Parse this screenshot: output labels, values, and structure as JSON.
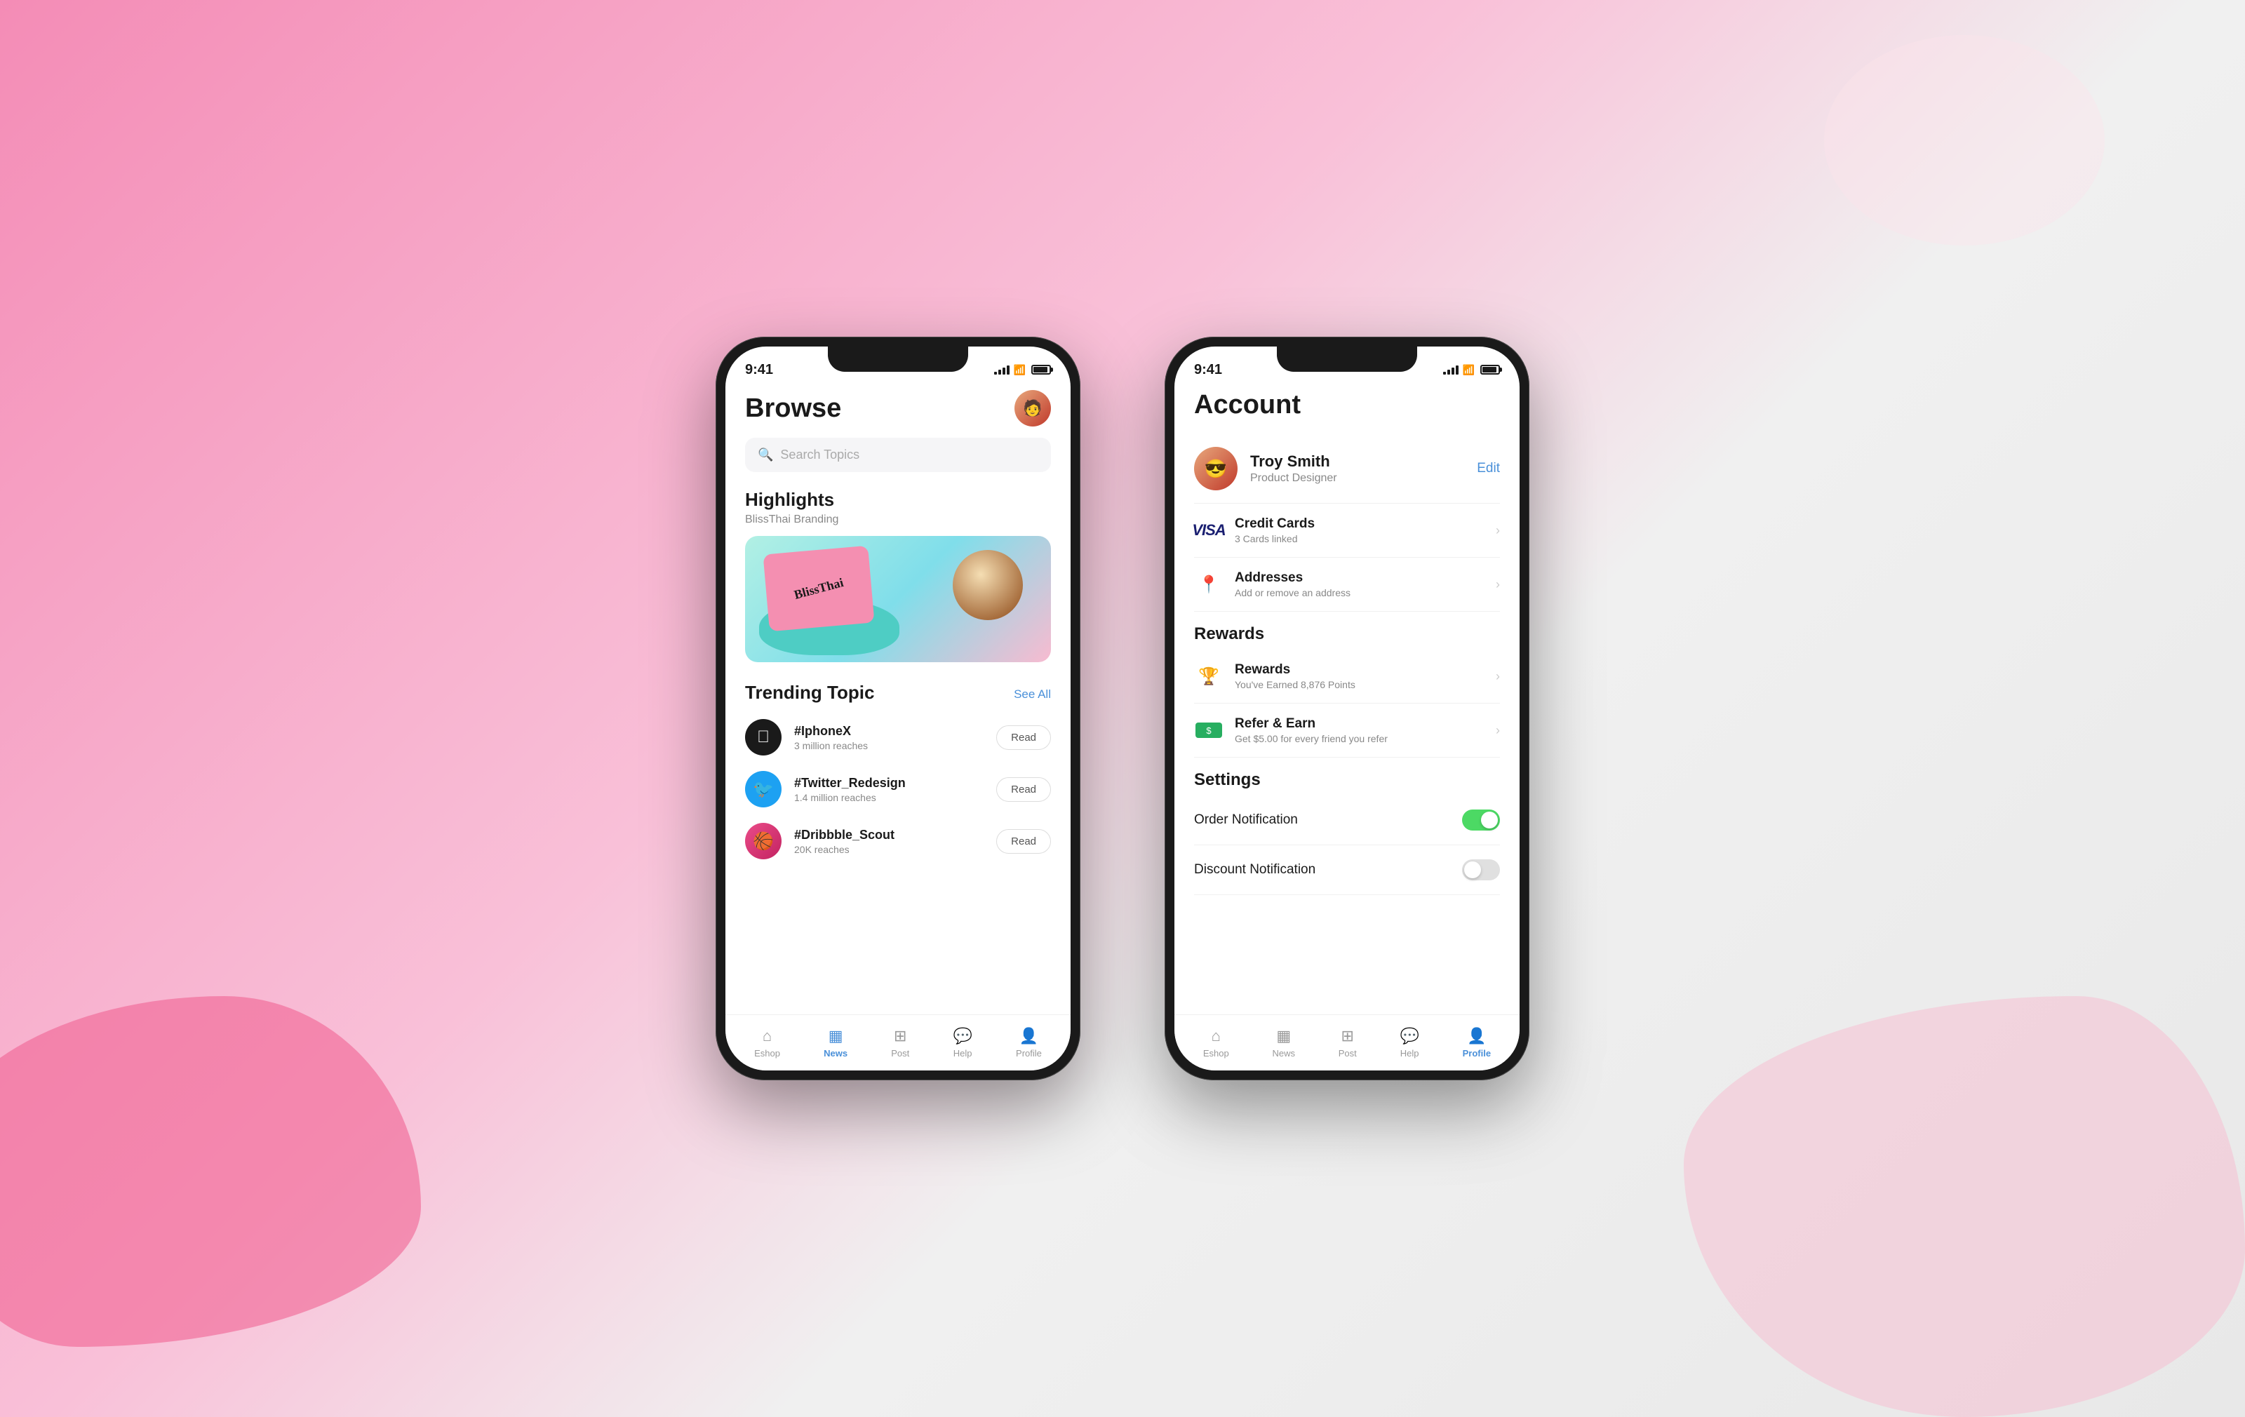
{
  "background": {
    "color_left": "#f48cb6",
    "color_right": "#e8e8e8"
  },
  "phone_browse": {
    "status_bar": {
      "time": "9:41",
      "signal": "full",
      "wifi": true,
      "battery": 85
    },
    "header": {
      "title": "Browse",
      "avatar_emoji": "👤"
    },
    "search": {
      "placeholder": "Search Topics"
    },
    "highlights": {
      "section_title": "Highlights",
      "subtitle": "BlissThai Branding",
      "card_text": "BlissThai"
    },
    "trending": {
      "section_title": "Trending Topic",
      "see_all_label": "See All",
      "items": [
        {
          "icon": "apple",
          "name": "#IphoneX",
          "reach": "3 million reaches",
          "btn": "Read"
        },
        {
          "icon": "twitter",
          "name": "#Twitter_Redesign",
          "reach": "1.4 million reaches",
          "btn": "Read"
        },
        {
          "icon": "dribbble",
          "name": "#Dribbble_Scout",
          "reach": "20K reaches",
          "btn": "Read"
        }
      ]
    },
    "bottom_nav": {
      "items": [
        {
          "label": "Eshop",
          "icon": "🏠",
          "active": false
        },
        {
          "label": "News",
          "icon": "📰",
          "active": true
        },
        {
          "label": "Post",
          "icon": "📮",
          "active": false
        },
        {
          "label": "Help",
          "icon": "💬",
          "active": false
        },
        {
          "label": "Profile",
          "icon": "👤",
          "active": false
        }
      ]
    }
  },
  "phone_account": {
    "status_bar": {
      "time": "9:41",
      "signal": "full",
      "wifi": true,
      "battery": 85
    },
    "header": {
      "title": "Account"
    },
    "profile": {
      "name": "Troy Smith",
      "role": "Product Designer",
      "edit_label": "Edit",
      "avatar_emoji": "😎"
    },
    "payment_section": {
      "items": [
        {
          "icon_type": "visa",
          "title": "Credit Cards",
          "subtitle": "3 Cards linked"
        },
        {
          "icon_type": "pin",
          "title": "Addresses",
          "subtitle": "Add or remove an address"
        }
      ]
    },
    "rewards_section": {
      "title": "Rewards",
      "items": [
        {
          "icon_type": "trophy",
          "title": "Rewards",
          "subtitle": "You've Earned 8,876 Points"
        },
        {
          "icon_type": "refer",
          "title": "Refer & Earn",
          "subtitle": "Get $5.00 for every friend you refer"
        }
      ]
    },
    "settings_section": {
      "title": "Settings",
      "items": [
        {
          "label": "Order Notification",
          "toggle_state": "on"
        },
        {
          "label": "Discount Notification",
          "toggle_state": "off"
        }
      ]
    },
    "bottom_nav": {
      "items": [
        {
          "label": "Eshop",
          "icon": "🏠",
          "active": false
        },
        {
          "label": "News",
          "icon": "📰",
          "active": false
        },
        {
          "label": "Post",
          "icon": "📮",
          "active": false
        },
        {
          "label": "Help",
          "icon": "💬",
          "active": false
        },
        {
          "label": "Profile",
          "icon": "👤",
          "active": true
        }
      ]
    }
  }
}
